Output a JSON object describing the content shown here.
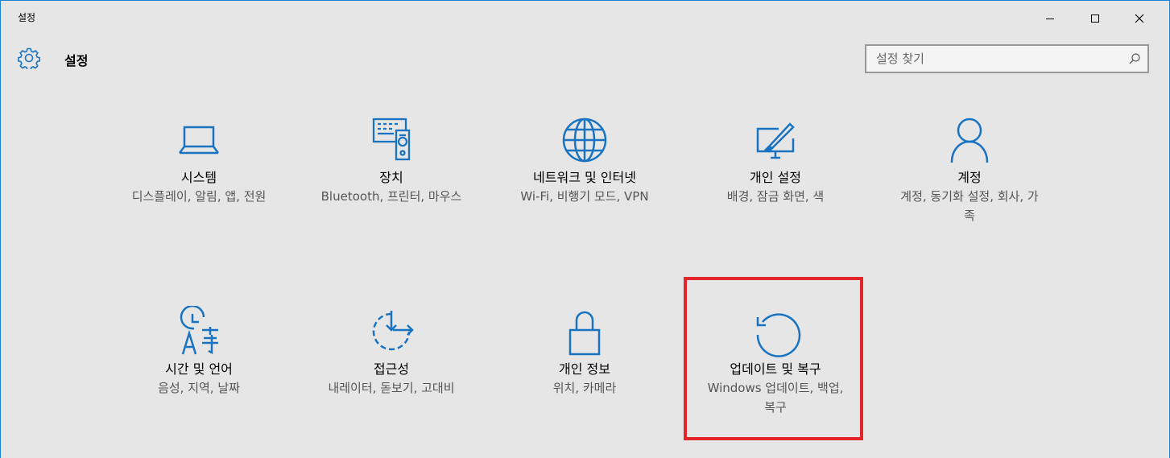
{
  "window": {
    "title": "설정",
    "minimize_symbol": "—",
    "maximize_symbol": "☐",
    "close_symbol": "✕"
  },
  "header": {
    "icon": "gear-icon",
    "title": "설정",
    "search_placeholder": "설정 찾기",
    "search_icon": "search-icon"
  },
  "tiles": [
    {
      "label": "시스템",
      "desc": "디스플레이, 알림, 앱, 전원",
      "icon": "laptop-icon"
    },
    {
      "label": "장치",
      "desc": "Bluetooth, 프린터, 마우스",
      "icon": "devices-icon"
    },
    {
      "label": "네트워크 및 인터넷",
      "desc": "Wi-Fi, 비행기 모드, VPN",
      "icon": "globe-icon"
    },
    {
      "label": "개인 설정",
      "desc": "배경, 잠금 화면, 색",
      "icon": "personalization-icon"
    },
    {
      "label": "계정",
      "desc": "계정, 동기화 설정, 회사, 가족",
      "icon": "person-icon"
    },
    {
      "label": "시간 및 언어",
      "desc": "음성, 지역, 날짜",
      "icon": "time-language-icon"
    },
    {
      "label": "접근성",
      "desc": "내레이터, 돋보기, 고대비",
      "icon": "ease-of-access-icon"
    },
    {
      "label": "개인 정보",
      "desc": "위치, 카메라",
      "icon": "lock-icon"
    },
    {
      "label": "업데이트 및 복구",
      "desc": "Windows 업데이트, 백업, 복구",
      "icon": "refresh-icon"
    }
  ],
  "colors": {
    "accent": "#1a73c0",
    "highlight_border": "#e3242b",
    "background": "#e6e6e6"
  }
}
